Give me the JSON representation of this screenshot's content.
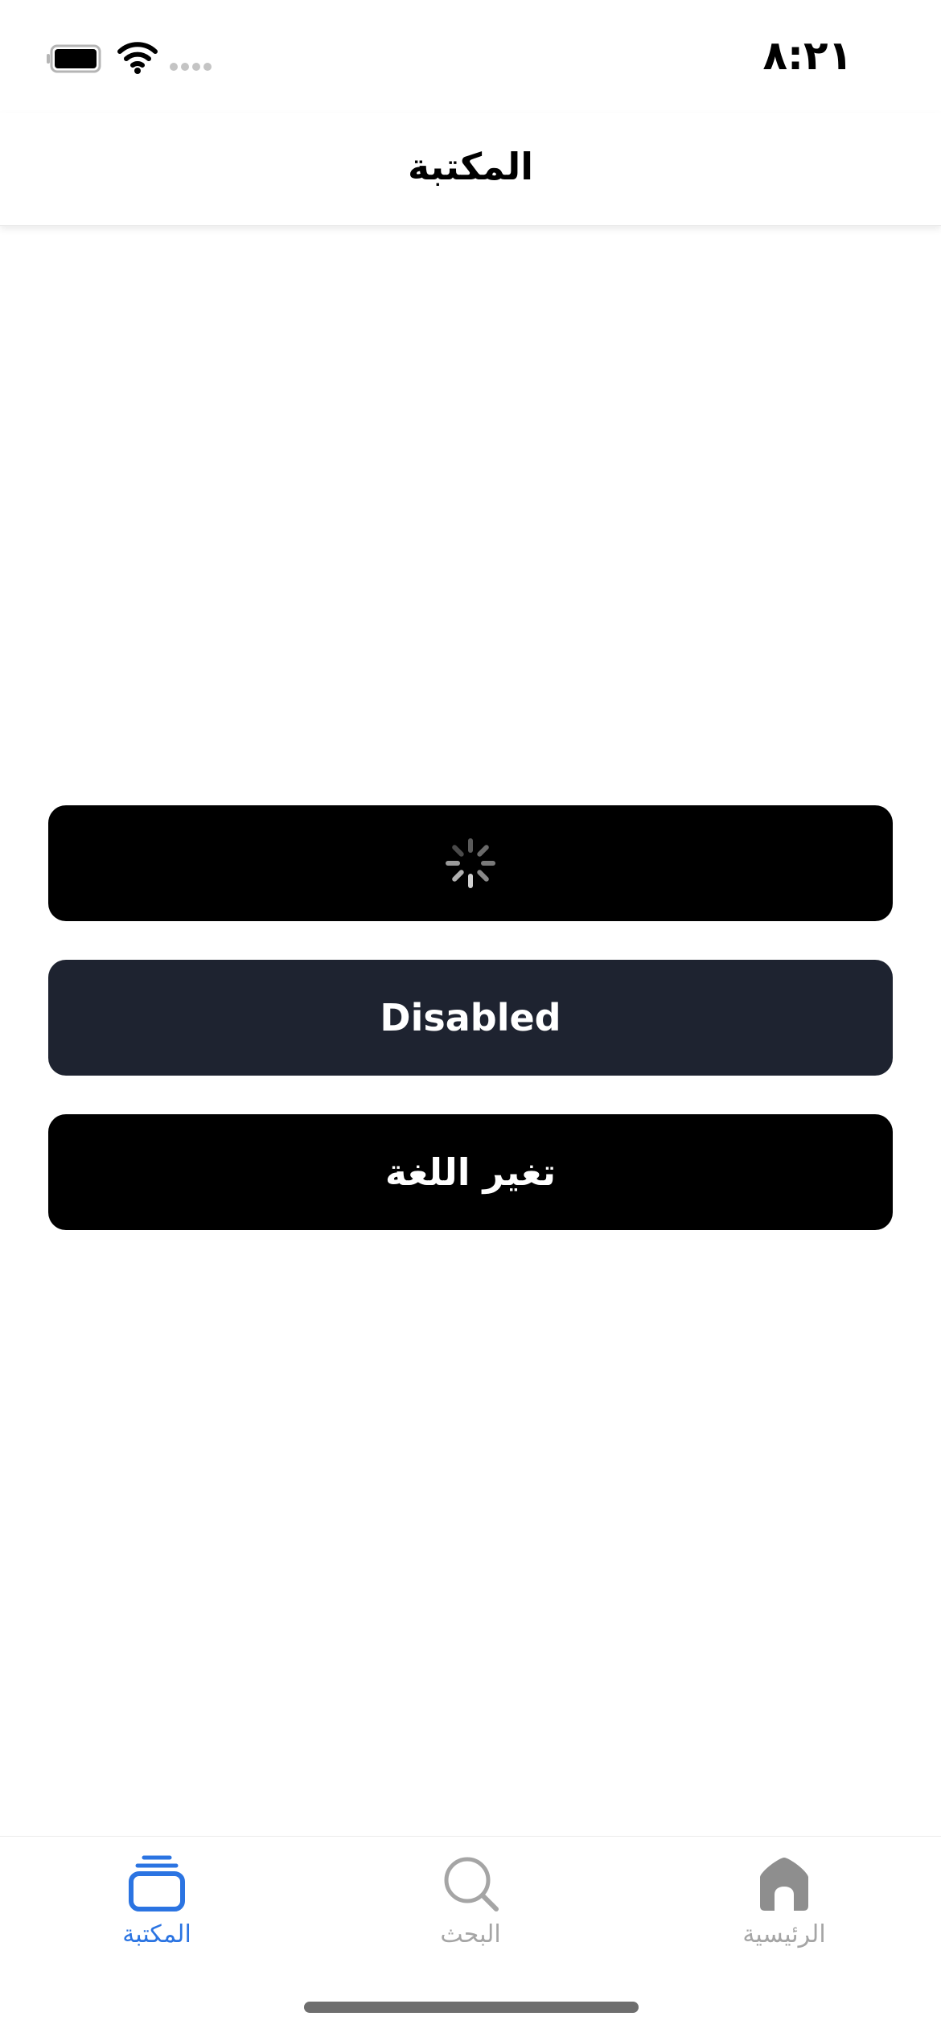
{
  "status_bar": {
    "time": "٨:٢١"
  },
  "nav": {
    "title": "المكتبة"
  },
  "buttons": {
    "disabled_label": "Disabled",
    "change_language_label": "تغير اللغة"
  },
  "tabs": [
    {
      "label": "المكتبة",
      "icon": "library-icon",
      "active": true
    },
    {
      "label": "البحث",
      "icon": "search-icon",
      "active": false
    },
    {
      "label": "الرئيسية",
      "icon": "home-icon",
      "active": false
    }
  ],
  "colors": {
    "accent": "#2b74e2",
    "inactive": "#a5a5a5",
    "button_primary": "#000000",
    "button_disabled": "#1e2330"
  }
}
